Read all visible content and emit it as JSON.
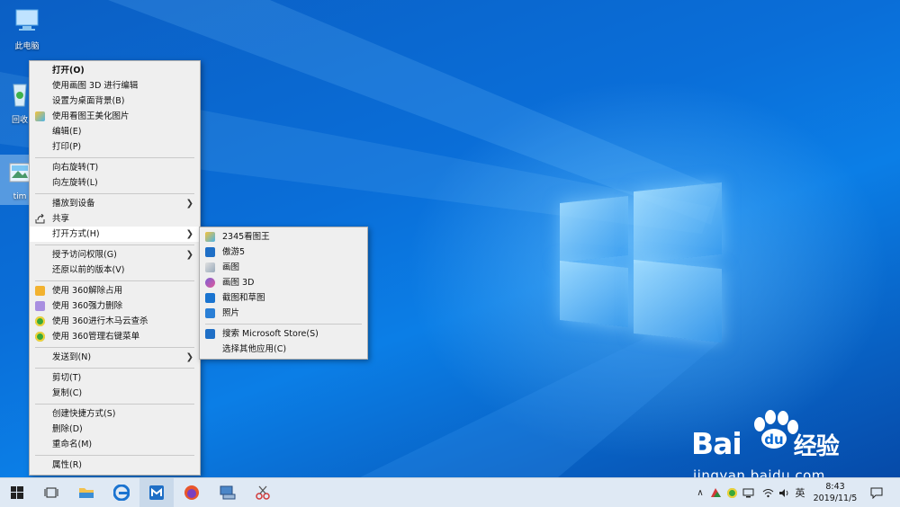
{
  "desktop": {
    "icons": [
      {
        "label": "此电脑"
      },
      {
        "label": "回收"
      },
      {
        "label": "tim"
      }
    ]
  },
  "context_menu": {
    "items": [
      {
        "label": "打开(O)"
      },
      {
        "label": "使用画图 3D 进行编辑"
      },
      {
        "label": "设置为桌面背景(B)"
      },
      {
        "label": "使用看图王美化图片"
      },
      {
        "label": "编辑(E)"
      },
      {
        "label": "打印(P)"
      },
      {
        "label": "向右旋转(T)"
      },
      {
        "label": "向左旋转(L)"
      },
      {
        "label": "播放到设备"
      },
      {
        "label": "共享"
      },
      {
        "label": "打开方式(H)"
      },
      {
        "label": "授予访问权限(G)"
      },
      {
        "label": "还原以前的版本(V)"
      },
      {
        "label": "使用 360解除占用"
      },
      {
        "label": "使用 360强力删除"
      },
      {
        "label": "使用 360进行木马云查杀"
      },
      {
        "label": "使用 360管理右键菜单"
      },
      {
        "label": "发送到(N)"
      },
      {
        "label": "剪切(T)"
      },
      {
        "label": "复制(C)"
      },
      {
        "label": "创建快捷方式(S)"
      },
      {
        "label": "删除(D)"
      },
      {
        "label": "重命名(M)"
      },
      {
        "label": "属性(R)"
      }
    ]
  },
  "submenu": {
    "items": [
      {
        "label": "2345看图王"
      },
      {
        "label": "傲游5"
      },
      {
        "label": "画图"
      },
      {
        "label": "画图 3D"
      },
      {
        "label": "截图和草图"
      },
      {
        "label": "照片"
      },
      {
        "label": "搜索 Microsoft Store(S)"
      },
      {
        "label": "选择其他应用(C)"
      }
    ]
  },
  "taskbar": {
    "ime": "英",
    "time": "8:43",
    "date": "2019/11/5"
  },
  "watermark": {
    "brand": "Bai",
    "brand_suffix": "经验",
    "url": "jingyan.baidu.com"
  },
  "colors": {
    "desktop": "#0a64c8",
    "menu_bg": "#efefef",
    "taskbar": "#dfe9f4"
  }
}
